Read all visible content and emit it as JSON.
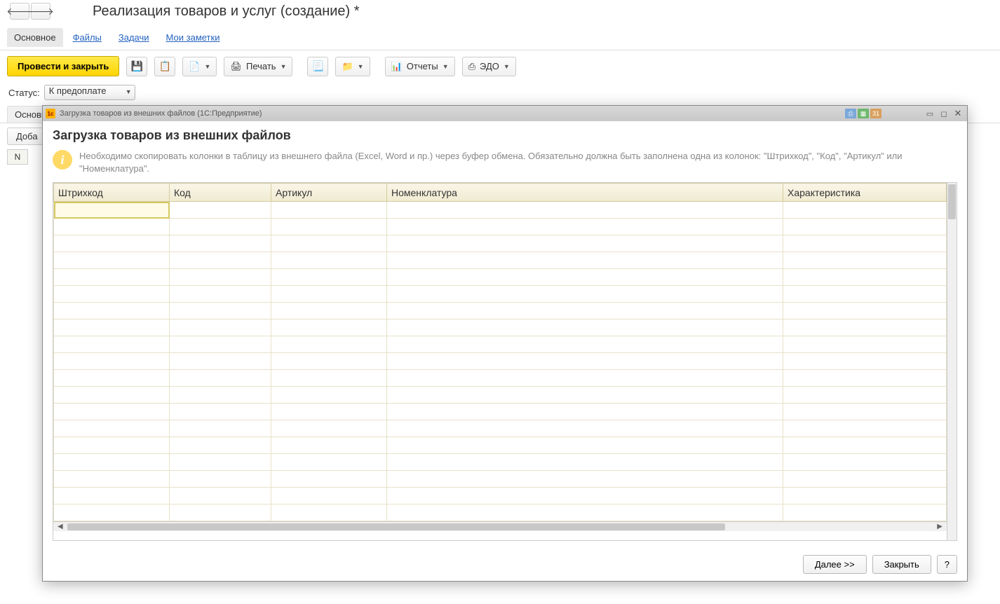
{
  "bg": {
    "page_title": "Реализация товаров и услуг (создание) *",
    "nav": {
      "main": "Основное",
      "files": "Файлы",
      "tasks": "Задачи",
      "notes": "Мои заметки"
    },
    "toolbar": {
      "post_close": "Провести и закрыть",
      "print": "Печать",
      "reports": "Отчеты",
      "edo": "ЭДО"
    },
    "status": {
      "label": "Статус:",
      "value": "К предоплате"
    },
    "sub_tab": "Основн",
    "sub_btn": "Доба",
    "col_n": "N"
  },
  "modal": {
    "titlebar": "Загрузка товаров из внешних файлов  (1С:Предприятие)",
    "heading": "Загрузка товаров из внешних файлов",
    "info": "Необходимо скопировать колонки в таблицу из внешнего файла (Excel, Word и пр.) через буфер обмена. Обязательно должна быть заполнена одна из колонок: \"Штрихкод\", \"Код\", \"Артикул\" или \"Номенклатура\".",
    "columns": {
      "barcode": "Штрихкод",
      "code": "Код",
      "article": "Артикул",
      "nomen": "Номенклатура",
      "char": "Характеристика"
    },
    "footer": {
      "next": "Далее >>",
      "close": "Закрыть",
      "help": "?"
    }
  }
}
